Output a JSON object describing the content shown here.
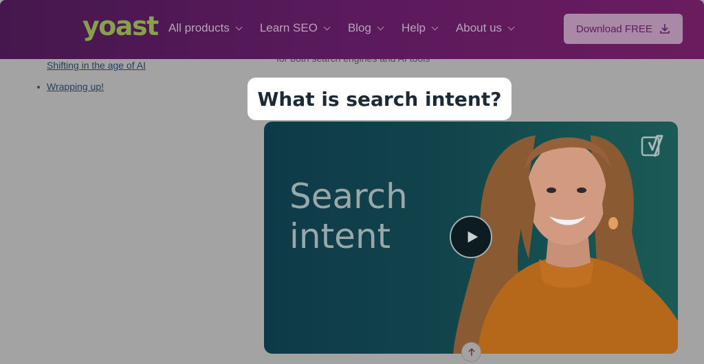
{
  "header": {
    "logo_text": "yoast",
    "nav": [
      {
        "label": "All products"
      },
      {
        "label": "Learn SEO"
      },
      {
        "label": "Blog"
      },
      {
        "label": "Help"
      },
      {
        "label": "About us"
      }
    ],
    "download_label": "Download FREE"
  },
  "toc": {
    "items": [
      {
        "label": "Shifting in the age of AI"
      },
      {
        "label": "Wrapping up!"
      }
    ]
  },
  "content": {
    "subtext": "for both search engines and AI tools",
    "heading": "What is search intent?",
    "video": {
      "title_line1": "Search",
      "title_line2": "intent"
    }
  },
  "colors": {
    "header_purple": "#5a1a5c",
    "logo_green": "#84a137",
    "video_teal": "#165252"
  }
}
